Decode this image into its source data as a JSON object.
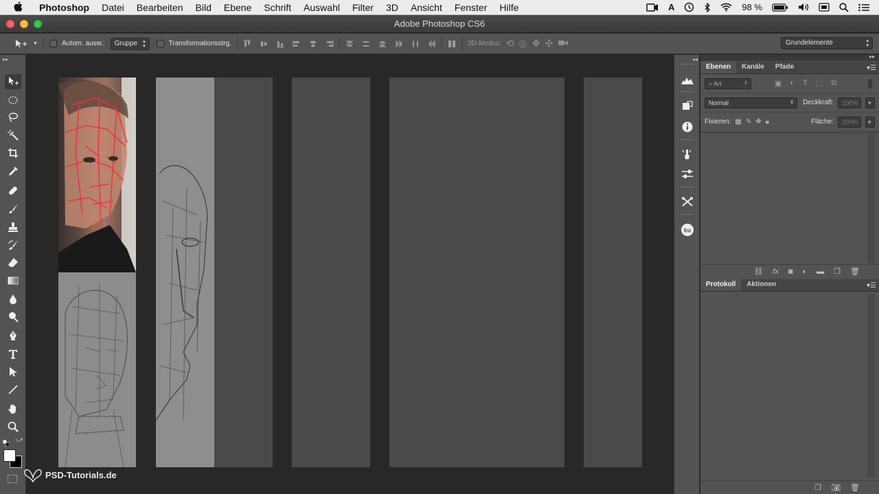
{
  "menubar": {
    "app_name": "Photoshop",
    "items": [
      "Datei",
      "Bearbeiten",
      "Bild",
      "Ebene",
      "Schrift",
      "Auswahl",
      "Filter",
      "3D",
      "Ansicht",
      "Fenster",
      "Hilfe"
    ],
    "battery": "98 %"
  },
  "window": {
    "title": "Adobe Photoshop CS6"
  },
  "options": {
    "auto_select_label": "Autom. ausw.:",
    "auto_select_value": "Gruppe",
    "transform_label": "Transformationsstrg.",
    "mode_3d_label": "3D-Modus:",
    "workspace": "Grundelemente"
  },
  "layers_panel": {
    "tabs": [
      "Ebenen",
      "Kanäle",
      "Pfade"
    ],
    "filter_kind": "Art",
    "blend_mode": "Normal",
    "opacity_label": "Deckkraft:",
    "opacity_value": "100%",
    "lock_label": "Fixieren:",
    "fill_label": "Fläche:",
    "fill_value": "100%"
  },
  "history_panel": {
    "tabs": [
      "Protokoll",
      "Aktionen"
    ]
  },
  "watermark": "PSD-Tutorials.de",
  "colors": {
    "accent_red": "#e8333b",
    "traffic_close": "#fc605c",
    "traffic_min": "#fdbc40",
    "traffic_max": "#34c84a"
  }
}
